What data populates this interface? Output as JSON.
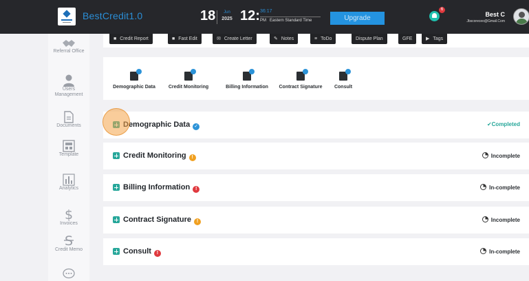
{
  "app": {
    "brand": "BestCredit1.0"
  },
  "header": {
    "date": {
      "day": "18",
      "month": "Jun",
      "year": "2025"
    },
    "time": {
      "hour": "12:",
      "minutes": "36:17",
      "ampm": "PM",
      "zone": "Eastern Standard Time"
    },
    "upgrade_label": "Upgrade",
    "notifications_count": "6",
    "user": {
      "name": "Best C",
      "email": "Jbscoreceo@Gmail.Com"
    }
  },
  "sidebar": {
    "items": [
      {
        "label": "Referral Office",
        "icon": "handshake-icon"
      },
      {
        "label": "Users Management",
        "icon": "user-icon"
      },
      {
        "label": "Documents",
        "icon": "document-icon"
      },
      {
        "label": "Template",
        "icon": "template-icon"
      },
      {
        "label": "Analytics",
        "icon": "bar-chart-icon"
      },
      {
        "label": "Invoices",
        "icon": "dollar-icon"
      },
      {
        "label": "Credit Memo",
        "icon": "strike-dollar-icon"
      },
      {
        "label": "",
        "icon": "chat-icon"
      }
    ]
  },
  "toolbar": {
    "buttons": [
      {
        "label": "Credit Report",
        "icon": "folder-icon"
      },
      {
        "label": "Fast Edit",
        "icon": "folder-icon"
      },
      {
        "label": "Create Letter",
        "icon": "envelope-icon"
      },
      {
        "label": "Notes",
        "icon": "pencil-icon"
      },
      {
        "label": "ToDo",
        "icon": "list-icon"
      },
      {
        "label": "Dispute Plan",
        "icon": ""
      },
      {
        "label": "GFE",
        "icon": ""
      },
      {
        "label": "Tags",
        "icon": "tag-icon"
      }
    ]
  },
  "steps": [
    {
      "label": "Demographic Data",
      "icon": "truck-check-icon"
    },
    {
      "label": "Credit Monitoring",
      "icon": "card-check-icon"
    },
    {
      "label": "Billing Information",
      "icon": "invoice-check-icon"
    },
    {
      "label": "Contract Signature",
      "icon": "contract-check-icon"
    },
    {
      "label": "Consult",
      "icon": "person-check-icon"
    }
  ],
  "sections": [
    {
      "title": "Demographic Data",
      "badge": "✓",
      "status": "✔Completed"
    },
    {
      "title": "Credit Monitoring",
      "badge": "!",
      "status": "Incomplete"
    },
    {
      "title": "Billing Information",
      "badge": "!",
      "status": "In-complete"
    },
    {
      "title": "Contract Signature",
      "badge": "!",
      "status": "Incomplete"
    },
    {
      "title": "Consult",
      "badge": "!",
      "status": "In-complete"
    }
  ],
  "colors": {
    "topbar": "#26272b",
    "brand": "#2b8ed6",
    "upgrade": "#2493e0",
    "plus": "#27a79a",
    "badge_ok": "#2c93d8",
    "badge_warn": "#f0a020",
    "badge_err": "#e0393e",
    "highlight": "#f4a448"
  }
}
